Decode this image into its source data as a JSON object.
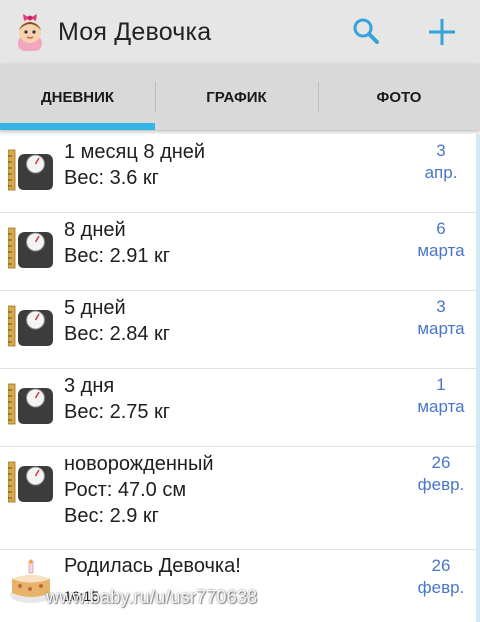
{
  "app": {
    "title": "Моя Девочка"
  },
  "colors": {
    "tab_indicator": "#33b5e5",
    "date_text": "#4a76c8",
    "action_icon": "#33a3d9"
  },
  "icons": {
    "app": "baby-girl-icon",
    "search": "search-icon",
    "add": "add-icon",
    "weight": "scale-ruler-icon",
    "birth": "birthday-cake-icon"
  },
  "tabs": [
    {
      "label": "ДНЕВНИК",
      "selected": true
    },
    {
      "label": "ГРАФИК",
      "selected": false
    },
    {
      "label": "ФОТО",
      "selected": false
    }
  ],
  "entries": [
    {
      "line1": "1 месяц 8 дней",
      "line2": "Вес: 3.6 кг",
      "date_day": "3",
      "date_month": "апр."
    },
    {
      "line1": "8 дней",
      "line2": "Вес: 2.91 кг",
      "date_day": "6",
      "date_month": "марта"
    },
    {
      "line1": "5 дней",
      "line2": "Вес: 2.84 кг",
      "date_day": "3",
      "date_month": "марта"
    },
    {
      "line1": "3 дня",
      "line2": "Вес: 2.75 кг",
      "date_day": "1",
      "date_month": "марта"
    },
    {
      "line1": "новорожденный",
      "line2": "Рост: 47.0 см",
      "line3": "Вес: 2.9 кг",
      "date_day": "26",
      "date_month": "февр."
    },
    {
      "line1": "Родилась Девочка!",
      "time": "16:15",
      "date_day": "26",
      "date_month": "февр."
    }
  ],
  "watermark": "www.baby.ru/u/usr770638"
}
